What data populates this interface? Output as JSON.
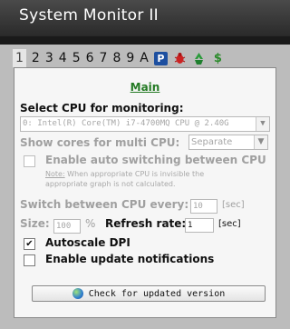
{
  "window": {
    "title": "System Monitor II"
  },
  "tabs": [
    "1",
    "2",
    "3",
    "4",
    "5",
    "6",
    "7",
    "8",
    "9",
    "A"
  ],
  "tab_icons": [
    "p-icon",
    "bug-icon",
    "recycle-icon",
    "dollar-icon"
  ],
  "tab_dollar": "$",
  "tab_p": "P",
  "panel": {
    "title": "Main",
    "select_cpu_label": "Select CPU for monitoring:",
    "cpu_value": "0: Intel(R) Core(TM) i7-4700MQ CPU @ 2.40G",
    "show_cores_label": "Show cores for multi CPU:",
    "show_cores_value": "Separate",
    "auto_switch_label": "Enable auto switching between CPU",
    "note_label": "Note:",
    "note_line1": " When appropriate CPU is invisible the",
    "note_line2": "appropriate graph is not calculated.",
    "switch_every_label": "Switch between CPU every:",
    "switch_every_value": "10",
    "sec_unit": "[sec]",
    "size_label": "Size:",
    "size_value": "100",
    "size_unit": "%",
    "refresh_label": "Refresh rate:",
    "refresh_value": "1",
    "refresh_unit": "[sec]",
    "autoscale_label": "Autoscale DPI",
    "autoscale_checked": "✔",
    "update_notif_label": "Enable update notifications",
    "check_button_label": "Check for updated version"
  },
  "colors": {
    "title_bg": "#3a3a3a",
    "frame_bg": "#bcbcbc",
    "panel_bg": "#f6f6f6",
    "accent_green": "#237a23",
    "disabled": "#a0a0a0"
  }
}
